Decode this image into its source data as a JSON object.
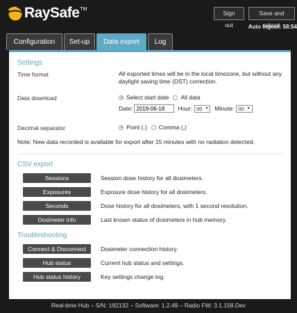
{
  "header": {
    "brand": "RaySafe",
    "brand_tm": "TM",
    "signout_label": "Sign out",
    "save_label": "Save and reboot",
    "autologout": "Auto logout: 58:54"
  },
  "tabs": [
    {
      "label": "Configuration"
    },
    {
      "label": "Set-up"
    },
    {
      "label": "Data export",
      "active": true
    },
    {
      "label": "Log"
    }
  ],
  "settings": {
    "heading": "Settings",
    "time_format_label": "Time format",
    "time_format_text": "All exported times will be in the local timezone, but without any daylight saving time (DST) correction.",
    "data_download_label": "Data download",
    "radio_start_date": "Select start date",
    "radio_all_data": "All data",
    "date_label": "Date:",
    "date_value": "2019-06-18",
    "hour_label": "Hour:",
    "hour_value": "00",
    "minute_label": "Minute:",
    "minute_value": "00",
    "decimal_label": "Decimal separator",
    "radio_point": "Point (.)",
    "radio_comma": "Comma (,)",
    "note": "Note: New data recorded is available for export after 15 minutes with no radiation detected."
  },
  "csv": {
    "heading": "CSV export",
    "items": [
      {
        "button": "Sessions",
        "desc": "Session dose history for all dosimeters."
      },
      {
        "button": "Exposures",
        "desc": "Exposure dose history for all dosimeters."
      },
      {
        "button": "Seconds",
        "desc": "Dose history for all dosimeters, with 1 second resolution."
      },
      {
        "button": "Dosimeter info",
        "desc": "Last known status of dosimeters in hub memory."
      }
    ]
  },
  "troubleshooting": {
    "heading": "Troubleshooting",
    "items": [
      {
        "button": "Connect & Disconnect",
        "desc": "Dosimeter connection history."
      },
      {
        "button": "Hub status",
        "desc": "Current hub status and settings."
      },
      {
        "button": "Hub status history",
        "desc": "Key settings change log."
      }
    ]
  },
  "footer": {
    "text": "Real-time Hub – S/N: 192132 – Software: 1.2.49 – Radio FW: 3.1.158.Dev"
  },
  "colors": {
    "accent": "#5fa9c4",
    "logo_yellow": "#f3b517",
    "background": "#1a1a1a"
  }
}
